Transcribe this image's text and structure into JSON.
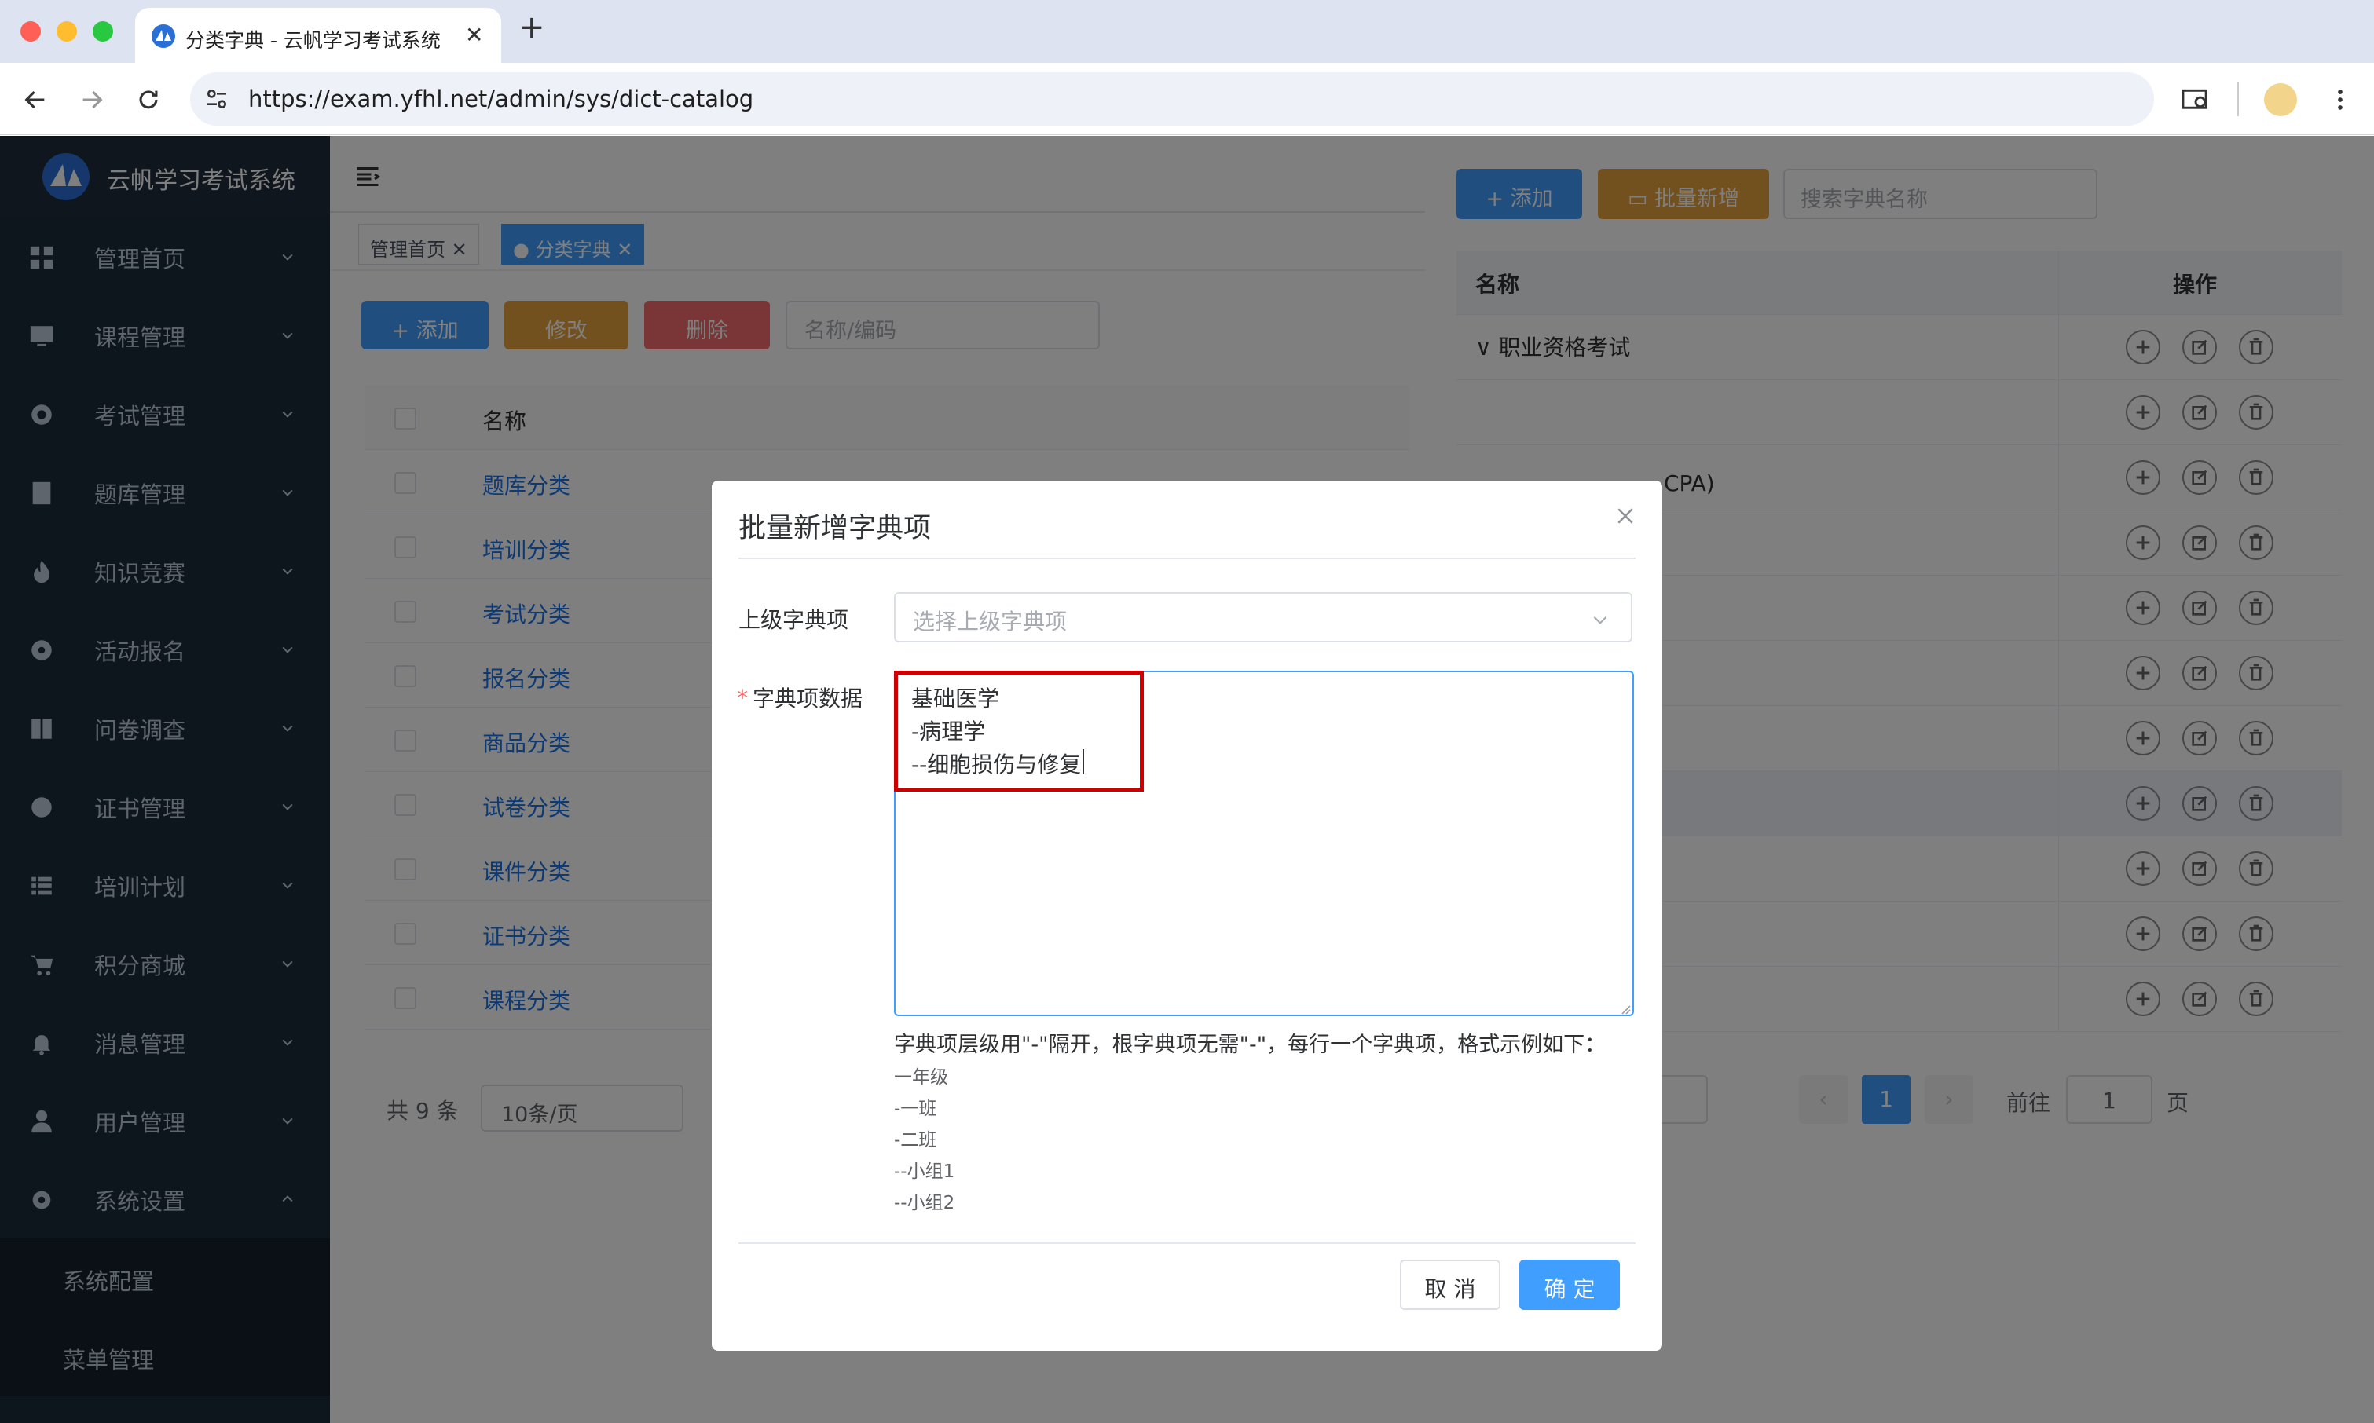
{
  "browser": {
    "tab_title": "分类字典 - 云帆学习考试系统",
    "url": "https://exam.yfhl.net/admin/sys/dict-catalog",
    "new_tab": "+",
    "close_tab": "✕"
  },
  "app": {
    "name": "云帆学习考试系统",
    "sidebar": [
      {
        "label": "管理首页",
        "icon": "dashboard-icon"
      },
      {
        "label": "课程管理",
        "icon": "monitor-icon"
      },
      {
        "label": "考试管理",
        "icon": "target-icon"
      },
      {
        "label": "题库管理",
        "icon": "document-icon"
      },
      {
        "label": "知识竞赛",
        "icon": "fire-icon"
      },
      {
        "label": "活动报名",
        "icon": "compass-icon"
      },
      {
        "label": "问卷调查",
        "icon": "book-icon"
      },
      {
        "label": "证书管理",
        "icon": "badge-icon"
      },
      {
        "label": "培训计划",
        "icon": "list-icon"
      },
      {
        "label": "积分商城",
        "icon": "cart-icon"
      },
      {
        "label": "消息管理",
        "icon": "bell-icon"
      },
      {
        "label": "用户管理",
        "icon": "user-icon"
      },
      {
        "label": "系统设置",
        "icon": "gear-icon"
      }
    ],
    "sidebar_sub": [
      "系统配置",
      "菜单管理"
    ],
    "tags": [
      "管理首页",
      "分类字典"
    ],
    "toolbar": {
      "add": "+ 添加",
      "edit": "修改",
      "delete": "删除",
      "search_placeholder": "名称/编码"
    },
    "table_header": "名称",
    "rows": [
      "题库分类",
      "培训分类",
      "考试分类",
      "报名分类",
      "商品分类",
      "试卷分类",
      "课件分类",
      "证书分类",
      "课程分类"
    ],
    "footer": {
      "total": "共 9 条",
      "page_size": "10条/页"
    }
  },
  "drawer": {
    "add": "+ 添加",
    "batch_add": "批量新增",
    "search_placeholder": "搜索字典名称",
    "col_name": "名称",
    "col_ops": "操作",
    "first_row": "∨ 职业资格考试",
    "cpa_text": "CPA)",
    "page_size_tail": "页",
    "current_page": "1",
    "goto_label": "前往",
    "goto_value": "1",
    "goto_suffix": "页"
  },
  "dialog": {
    "title": "批量新增字典项",
    "parent_label": "上级字典项",
    "parent_placeholder": "选择上级字典项",
    "required_mark": "*",
    "data_label": "字典项数据",
    "data_lines": [
      "基础医学",
      "-病理学",
      "--细胞损伤与修复"
    ],
    "hint": "字典项层级用\"-\"隔开，根字典项无需\"-\"，每行一个字典项，格式示例如下：",
    "examples": [
      "一年级",
      "-一班",
      "-二班",
      "--小组1",
      "--小组2"
    ],
    "cancel": "取 消",
    "confirm": "确 定"
  },
  "colors": {
    "primary": "#409eff",
    "warning": "#e6a23c",
    "danger": "#f56c6c",
    "sidebar": "#1b2a3b",
    "highlight_box": "#cc0000"
  }
}
